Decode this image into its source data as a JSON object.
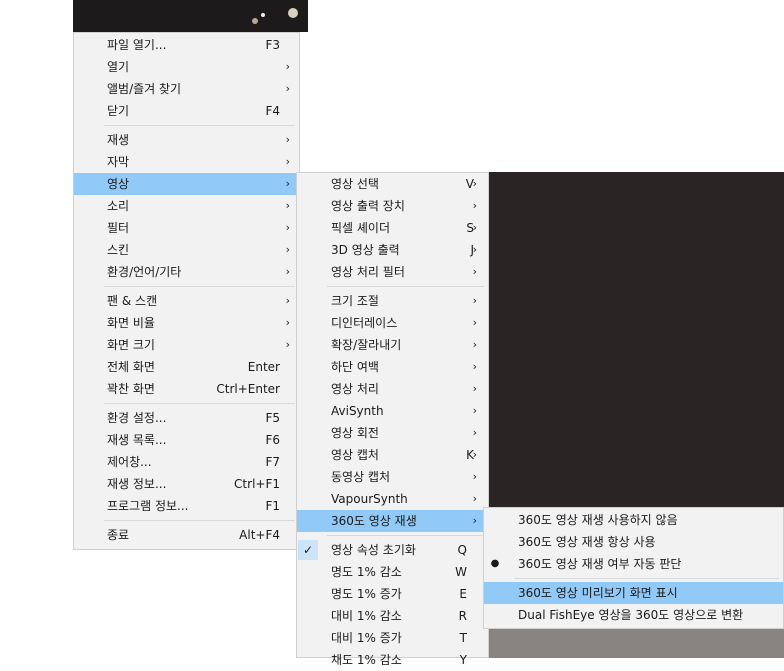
{
  "main_menu": {
    "groups": [
      [
        {
          "label": "파일 열기...",
          "shortcut": "F3"
        },
        {
          "label": "열기",
          "submenu": true
        },
        {
          "label": "앨범/즐겨 찾기",
          "submenu": true
        },
        {
          "label": "닫기",
          "shortcut": "F4"
        }
      ],
      [
        {
          "label": "재생",
          "submenu": true
        },
        {
          "label": "자막",
          "submenu": true
        },
        {
          "label": "영상",
          "submenu": true,
          "highlighted": true
        },
        {
          "label": "소리",
          "submenu": true
        },
        {
          "label": "필터",
          "submenu": true
        },
        {
          "label": "스킨",
          "submenu": true
        },
        {
          "label": "환경/언어/기타",
          "submenu": true
        }
      ],
      [
        {
          "label": "팬 & 스캔",
          "submenu": true
        },
        {
          "label": "화면 비율",
          "submenu": true
        },
        {
          "label": "화면 크기",
          "submenu": true
        },
        {
          "label": "전체 화면",
          "shortcut": "Enter"
        },
        {
          "label": "꽉찬 화면",
          "shortcut": "Ctrl+Enter"
        }
      ],
      [
        {
          "label": "환경 설정...",
          "shortcut": "F5"
        },
        {
          "label": "재생 목록...",
          "shortcut": "F6"
        },
        {
          "label": "제어창...",
          "shortcut": "F7"
        },
        {
          "label": "재생 정보...",
          "shortcut": "Ctrl+F1"
        },
        {
          "label": "프로그램 정보...",
          "shortcut": "F1"
        }
      ],
      [
        {
          "label": "종료",
          "shortcut": "Alt+F4"
        }
      ]
    ]
  },
  "video_menu": {
    "groups": [
      [
        {
          "label": "영상 선택",
          "shortcut": "V",
          "submenu": true
        },
        {
          "label": "영상 출력 장치",
          "submenu": true
        },
        {
          "label": "픽셀 셰이더",
          "shortcut": "S",
          "submenu": true
        },
        {
          "label": "3D 영상 출력",
          "shortcut": "J",
          "submenu": true
        },
        {
          "label": "영상 처리 필터",
          "submenu": true
        }
      ],
      [
        {
          "label": "크기 조절",
          "submenu": true
        },
        {
          "label": "디인터레이스",
          "submenu": true
        },
        {
          "label": "확장/잘라내기",
          "submenu": true
        },
        {
          "label": "하단 여백",
          "submenu": true
        },
        {
          "label": "영상 처리",
          "submenu": true
        },
        {
          "label": "AviSynth",
          "submenu": true
        },
        {
          "label": "영상 회전",
          "submenu": true
        },
        {
          "label": "영상 캡처",
          "shortcut": "K",
          "submenu": true
        },
        {
          "label": "동영상 캡처",
          "submenu": true
        },
        {
          "label": "VapourSynth",
          "submenu": true
        },
        {
          "label": "360도 영상 재생",
          "submenu": true,
          "highlighted": true
        }
      ],
      [
        {
          "label": "영상 속성 초기화",
          "shortcut": "Q",
          "checked": true
        },
        {
          "label": "명도 1% 감소",
          "shortcut": "W"
        },
        {
          "label": "명도 1% 증가",
          "shortcut": "E"
        },
        {
          "label": "대비 1% 감소",
          "shortcut": "R"
        },
        {
          "label": "대비 1% 증가",
          "shortcut": "T"
        },
        {
          "label": "채도 1% 감소",
          "shortcut": "Y"
        }
      ]
    ]
  },
  "vr_menu": {
    "groups": [
      [
        {
          "label": "360도 영상 재생 사용하지 않음"
        },
        {
          "label": "360도 영상 재생 항상 사용"
        },
        {
          "label": "360도 영상 재생 여부 자동 판단",
          "radio": true
        }
      ],
      [
        {
          "label": "360도 영상 미리보기 화면 표시",
          "highlighted": true
        },
        {
          "label": "Dual FishEye 영상을 360도 영상으로 변환"
        }
      ]
    ]
  },
  "icons": {
    "submenu_arrow": "›",
    "check": "✓",
    "radio": "●"
  },
  "colors": {
    "menu_bg": "#f2f2f2",
    "highlight": "#91c9f7"
  }
}
